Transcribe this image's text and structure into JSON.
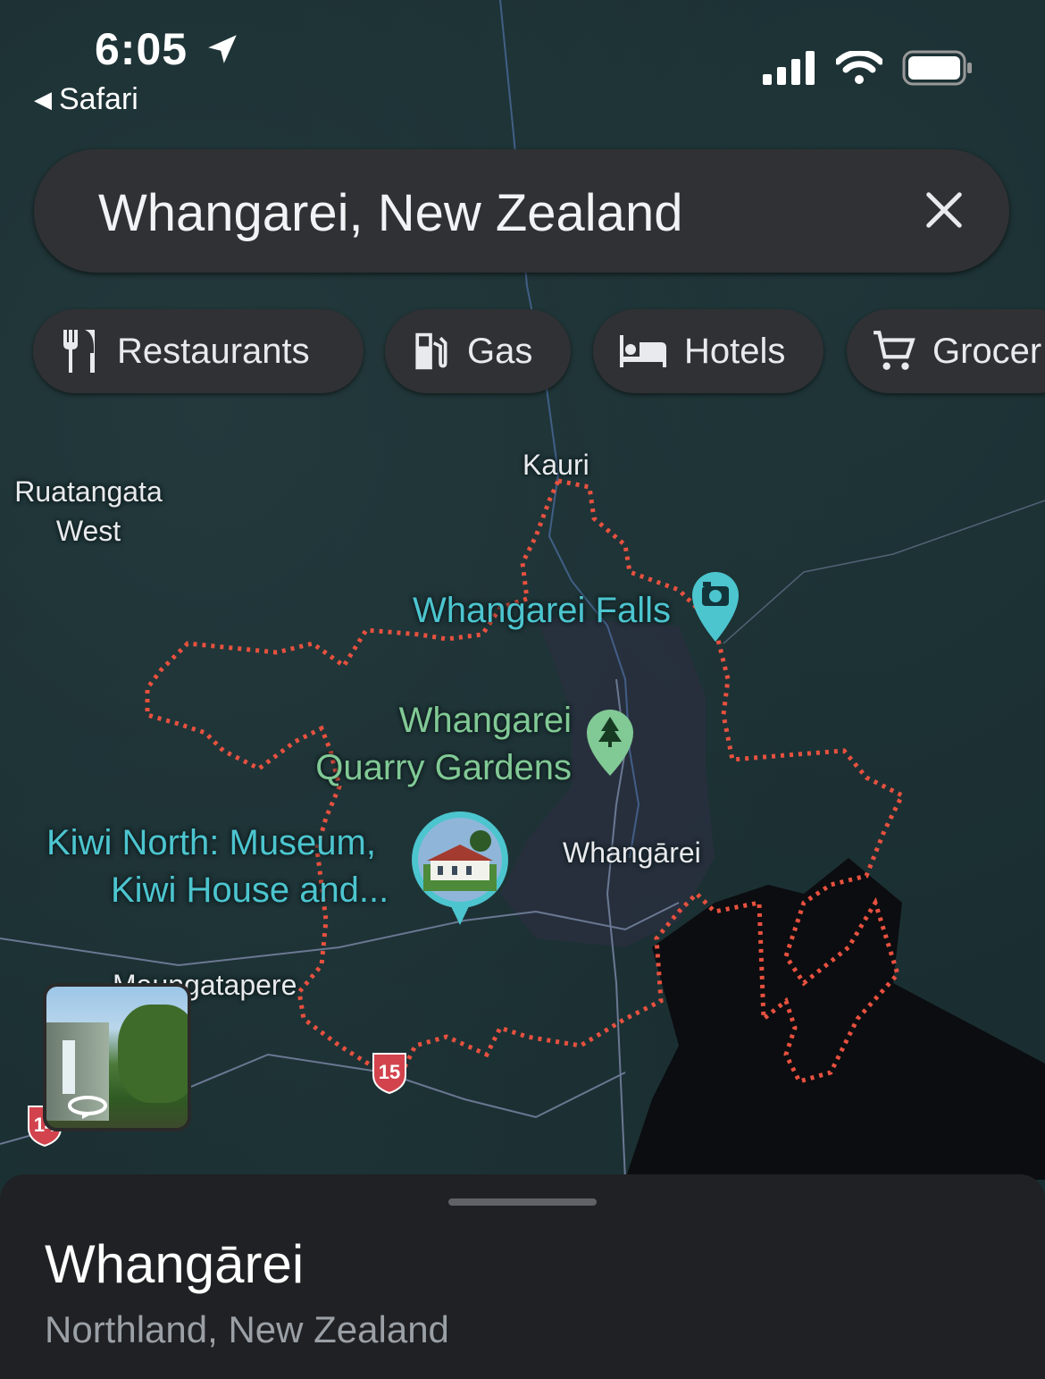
{
  "status_bar": {
    "time": "6:05",
    "back_app": "Safari",
    "icons": [
      "location-arrow-icon",
      "cellular-signal-icon",
      "wifi-icon",
      "battery-icon"
    ]
  },
  "search": {
    "query": "Whangarei, New Zealand",
    "clear_icon": "close-icon"
  },
  "chips": [
    {
      "label": "Restaurants",
      "icon": "restaurant-icon"
    },
    {
      "label": "Gas",
      "icon": "gas-station-icon"
    },
    {
      "label": "Hotels",
      "icon": "hotel-bed-icon"
    },
    {
      "label": "Grocer",
      "icon": "shopping-cart-icon"
    }
  ],
  "map": {
    "places": {
      "kauri": "Kauri",
      "ruatangata": "Ruatangata\nWest",
      "whangarei_town": "Whangārei",
      "maungatapere": "Maungatapere"
    },
    "pois": {
      "falls": "Whangarei Falls",
      "quarry_line1": "Whangarei",
      "quarry_line2": "Quarry Gardens",
      "kiwi_line1": "Kiwi North: Museum,",
      "kiwi_line2": "Kiwi House and..."
    },
    "route_shields": [
      "15",
      "14"
    ],
    "colors": {
      "boundary": "#e8513f",
      "poi_blue": "#4cc5cf",
      "poi_green": "#81c995",
      "water": "#0b0d10",
      "urban": "#2b2f40"
    }
  },
  "sheet": {
    "title": "Whangārei",
    "subtitle": "Northland, New Zealand"
  }
}
